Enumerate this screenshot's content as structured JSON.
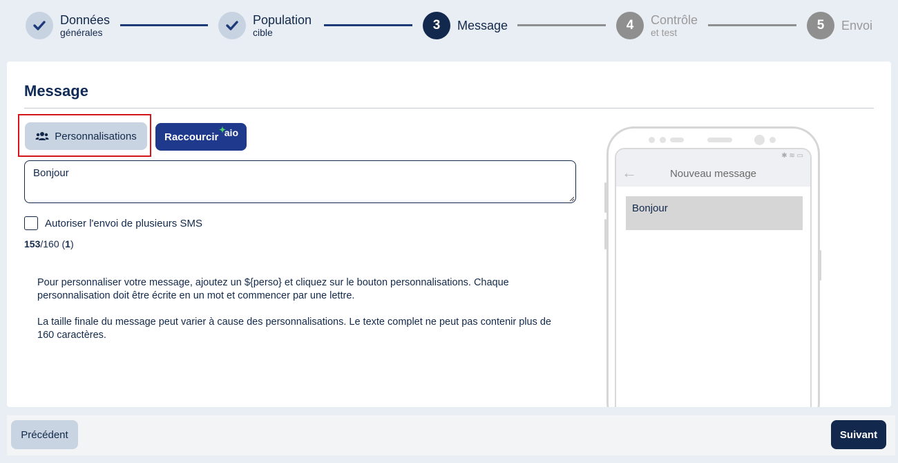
{
  "stepper": {
    "steps": [
      {
        "number": "",
        "label": "Données",
        "sub": "générales",
        "state": "done",
        "icon": "check-icon"
      },
      {
        "number": "",
        "label": "Population",
        "sub": "cible",
        "state": "done",
        "icon": "check-icon"
      },
      {
        "number": "3",
        "label": "Message",
        "sub": "",
        "state": "active"
      },
      {
        "number": "4",
        "label": "Contrôle",
        "sub": "et test",
        "state": "todo"
      },
      {
        "number": "5",
        "label": "Envoi",
        "sub": "",
        "state": "todo"
      }
    ]
  },
  "message": {
    "title": "Message",
    "personnalisations_label": "Personnalisations",
    "personnalisations_icon": "users-icon",
    "raccourcir_label": "Raccourcir",
    "raccourcir_logo": "aio",
    "text_value": "Bonjour",
    "multi_sms_label": "Autoriser l'envoi de plusieurs SMS",
    "multi_sms_checked": false,
    "counter_remaining": "153",
    "counter_max": "/160 (",
    "counter_sms_count": "1",
    "counter_close": ")",
    "help_paragraph_1": "Pour personnaliser votre message, ajoutez un ${perso} et cliquez sur le bouton personnalisations. Chaque personnalisation doit être écrite en un mot et commencer par une lettre.",
    "help_paragraph_2": "La taille finale du message peut varier à cause des personnalisations. Le texte complet ne peut pas contenir plus de 160 caractères."
  },
  "preview": {
    "header_title": "Nouveau message",
    "bubble_text": "Bonjour",
    "status_icons": "✱ ≋ ▭"
  },
  "footer": {
    "prev_label": "Précédent",
    "next_label": "Suivant"
  },
  "colors": {
    "primary": "#12284c",
    "accent_blue": "#1f3a8c",
    "button_secondary": "#c8d4e1",
    "highlight_red": "#d6141c",
    "aio_green": "#4cd46a"
  }
}
